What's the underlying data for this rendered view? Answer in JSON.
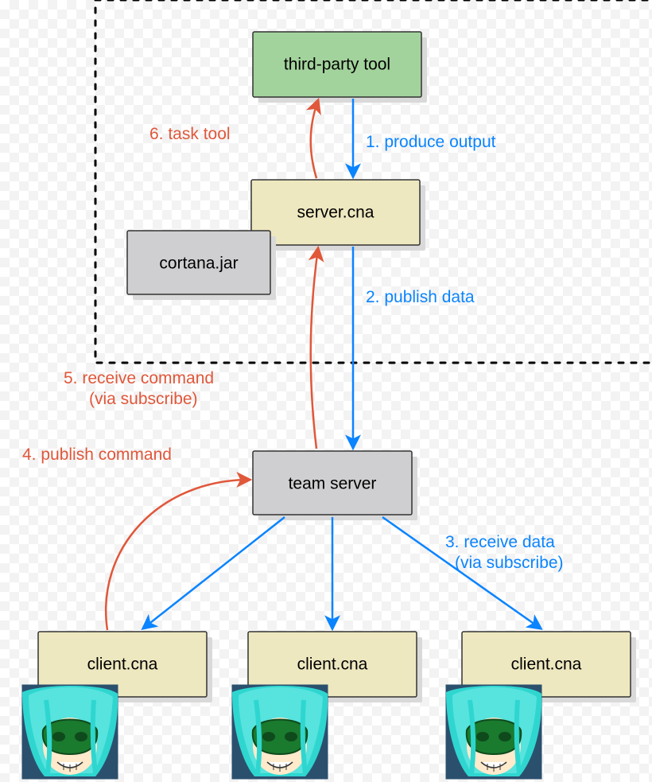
{
  "nodes": {
    "third_party_tool": "third-party tool",
    "server_cna": "server.cna",
    "cortana_jar": "cortana.jar",
    "team_server": "team server",
    "client1": "client.cna",
    "client2": "client.cna",
    "client3": "client.cna"
  },
  "steps": {
    "s1": "1. produce output",
    "s2": "2. publish data",
    "s3_line1": "3. receive data",
    "s3_line2": "(via subscribe)",
    "s4": "4. publish command",
    "s5_line1": "5. receive command",
    "s5_line2": "(via subscribe)",
    "s6": "6. task tool"
  },
  "colors": {
    "arrow_blue": "#0a84ff",
    "arrow_red": "#e0573a"
  }
}
